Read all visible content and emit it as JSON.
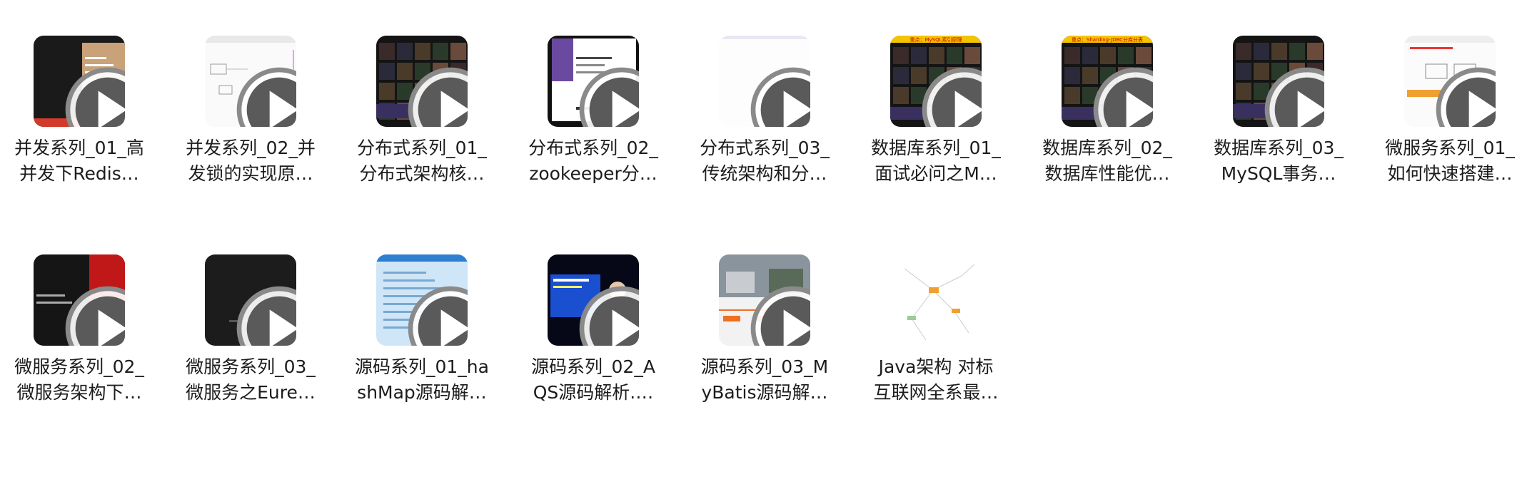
{
  "items": [
    {
      "line1": "并发系列_01_高",
      "line2": "并发下Redis…",
      "thumb": "dark-slide-gold"
    },
    {
      "line1": "并发系列_02_并",
      "line2": "发锁的实现原…",
      "thumb": "white-diagram"
    },
    {
      "line1": "分布式系列_01_",
      "line2": "分布式架构核…",
      "thumb": "dark-collage"
    },
    {
      "line1": "分布式系列_02_",
      "line2": "zookeeper分…",
      "thumb": "doc-purple"
    },
    {
      "line1": "分布式系列_03_",
      "line2": "传统架构和分…",
      "thumb": "blank-white"
    },
    {
      "line1": "数据库系列_01_",
      "line2": "面试必问之M…",
      "thumb": "dark-collage-banner",
      "banner": "重点：MySQL索引原理"
    },
    {
      "line1": "数据库系列_02_",
      "line2": "数据库性能优…",
      "thumb": "dark-collage-banner",
      "banner": "重点：Sharding-JDBC分库分表"
    },
    {
      "line1": "数据库系列_03_",
      "line2": "MySQL事务…",
      "thumb": "dark-collage"
    },
    {
      "line1": "微服务系列_01_",
      "line2": "如何快速搭建…",
      "thumb": "white-orange-diagram"
    },
    {
      "line1": "微服务系列_02_",
      "line2": "微服务架构下…",
      "thumb": "dark-red-slide"
    },
    {
      "line1": "微服务系列_03_",
      "line2": "微服务之Eure…",
      "thumb": "dark-plain"
    },
    {
      "line1": "源码系列_01_ha",
      "line2": "shMap源码解…",
      "thumb": "blue-screen"
    },
    {
      "line1": "源码系列_02_A",
      "line2": "QS源码解析.…",
      "thumb": "presenter"
    },
    {
      "line1": "源码系列_03_M",
      "line2": "yBatis源码解…",
      "thumb": "office-timeline"
    },
    {
      "line1": "Java架构 对标",
      "line2": "互联网全系最…",
      "thumb": "mindmap",
      "no_play": true
    }
  ],
  "icons": {
    "play": "play-circle-icon"
  }
}
